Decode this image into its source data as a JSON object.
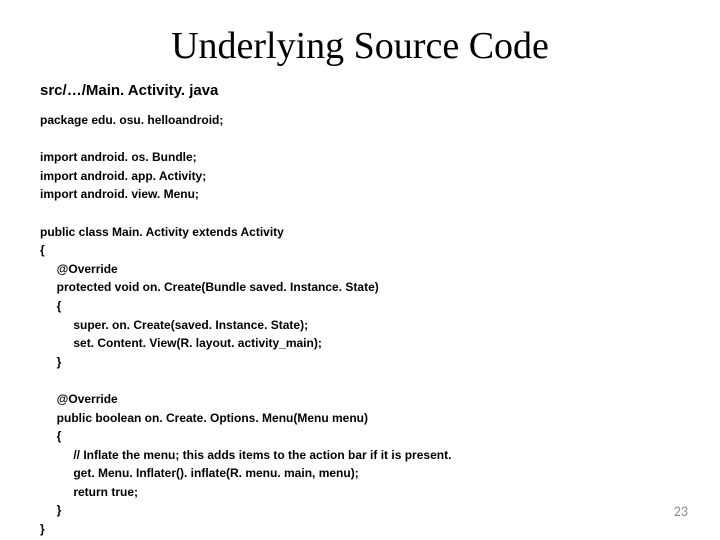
{
  "title": "Underlying Source Code",
  "file_path": "src/…/Main. Activity. java",
  "code": "package edu. osu. helloandroid;\n\nimport android. os. Bundle;\nimport android. app. Activity;\nimport android. view. Menu;\n\npublic class Main. Activity extends Activity\n{\n     @Override\n     protected void on. Create(Bundle saved. Instance. State)\n     {\n          super. on. Create(saved. Instance. State);\n          set. Content. View(R. layout. activity_main);\n     }\n\n     @Override\n     public boolean on. Create. Options. Menu(Menu menu)\n     {\n          // Inflate the menu; this adds items to the action bar if it is present.\n          get. Menu. Inflater(). inflate(R. menu. main, menu);\n          return true;\n     }\n}",
  "page_number": "23"
}
